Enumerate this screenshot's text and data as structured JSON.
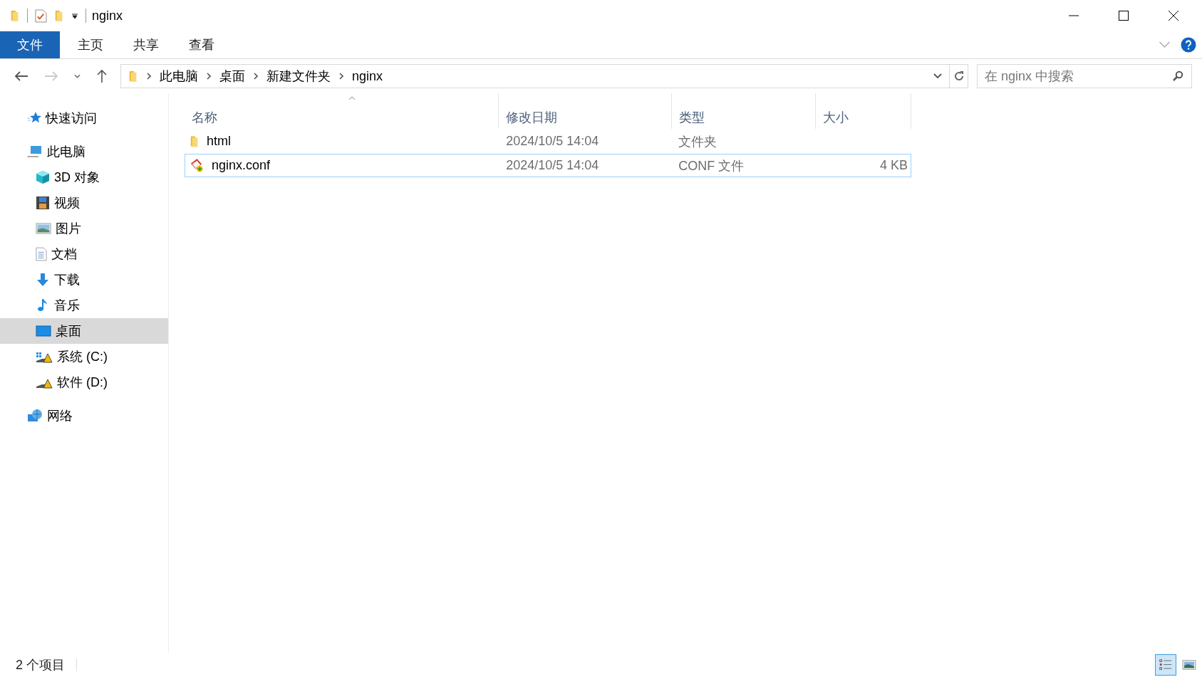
{
  "window": {
    "title": "nginx"
  },
  "ribbon": {
    "tabs": [
      {
        "label": "文件",
        "kind": "file"
      },
      {
        "label": "主页",
        "kind": "tab"
      },
      {
        "label": "共享",
        "kind": "tab"
      },
      {
        "label": "查看",
        "kind": "tab"
      }
    ]
  },
  "address": {
    "path": [
      "此电脑",
      "桌面",
      "新建文件夹",
      "nginx"
    ]
  },
  "search": {
    "placeholder": "在 nginx 中搜索"
  },
  "sidebar": {
    "items": [
      {
        "label": "快速访问",
        "kind": "star",
        "selected": false
      },
      {
        "label": "此电脑",
        "kind": "pc",
        "selected": false,
        "children": [
          {
            "label": "3D 对象",
            "kind": "cube",
            "selected": false
          },
          {
            "label": "视频",
            "kind": "film",
            "selected": false
          },
          {
            "label": "图片",
            "kind": "image",
            "selected": false
          },
          {
            "label": "文档",
            "kind": "doc",
            "selected": false
          },
          {
            "label": "下载",
            "kind": "download",
            "selected": false
          },
          {
            "label": "音乐",
            "kind": "music",
            "selected": false
          },
          {
            "label": "桌面",
            "kind": "desktop",
            "selected": true
          },
          {
            "label": "系统 (C:)",
            "kind": "drive_c",
            "selected": false
          },
          {
            "label": "软件 (D:)",
            "kind": "drive_d",
            "selected": false
          }
        ]
      },
      {
        "label": "网络",
        "kind": "network",
        "selected": false
      }
    ]
  },
  "table": {
    "columns": [
      "名称",
      "修改日期",
      "类型",
      "大小"
    ],
    "rows": [
      {
        "name": "html",
        "date": "2024/10/5 14:04",
        "type": "文件夹",
        "kind": "folder",
        "selected": false
      },
      {
        "name": "nginx.conf",
        "date": "2024/10/5 14:04",
        "type": "CONF 文件",
        "size": "4 KB",
        "kind": "conf",
        "selected": true
      }
    ]
  },
  "status_bar": {
    "item_count": "2 个项目",
    "views": [
      {
        "kind": "details",
        "selected": true
      },
      {
        "kind": "large_icons",
        "selected": false
      }
    ]
  }
}
